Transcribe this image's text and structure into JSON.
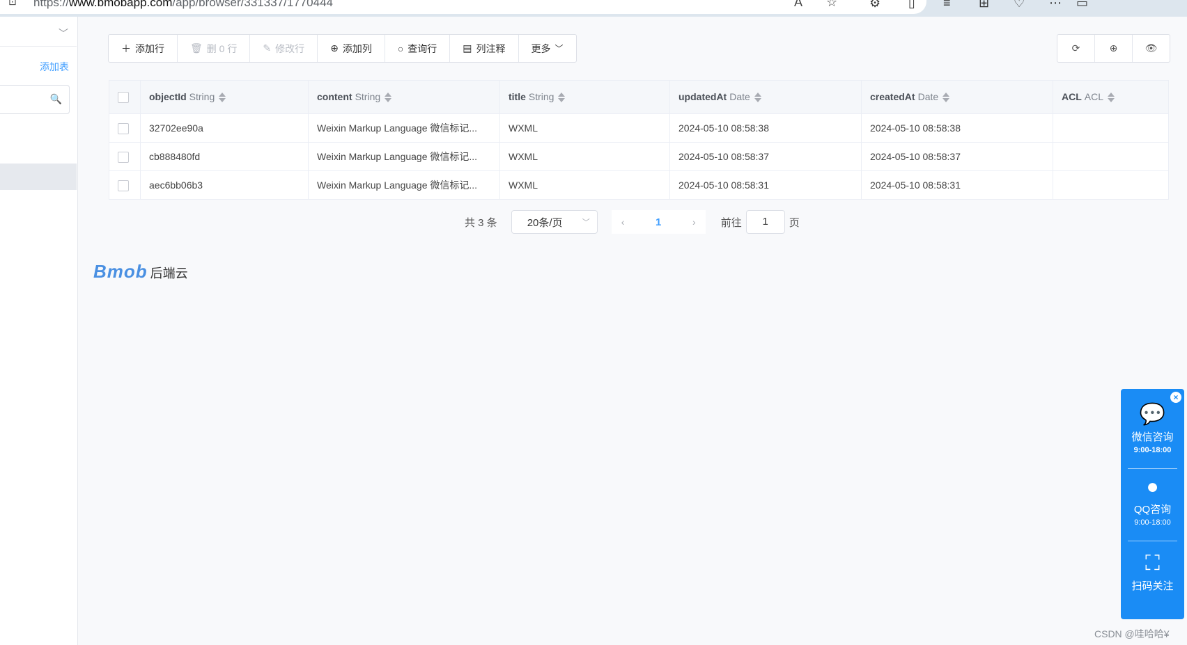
{
  "browser": {
    "url_prefix": "https://",
    "url_domain": "www.bmobapp.com",
    "url_path": "/app/browser/331337/1770444"
  },
  "sidebar": {
    "add_table_label": "添加表"
  },
  "toolbar": {
    "add_row": "添加行",
    "delete_rows": "删 0 行",
    "edit_row": "修改行",
    "add_column": "添加列",
    "query_row": "查询行",
    "column_notes": "列注释",
    "more": "更多"
  },
  "table": {
    "columns": [
      {
        "name": "objectId",
        "type": "String"
      },
      {
        "name": "content",
        "type": "String"
      },
      {
        "name": "title",
        "type": "String"
      },
      {
        "name": "updatedAt",
        "type": "Date"
      },
      {
        "name": "createdAt",
        "type": "Date"
      },
      {
        "name": "ACL",
        "type": "ACL"
      }
    ],
    "rows": [
      {
        "objectId": "32702ee90a",
        "content": "Weixin Markup Language 微信标记...",
        "title": "WXML",
        "updatedAt": "2024-05-10 08:58:38",
        "createdAt": "2024-05-10 08:58:38",
        "acl": ""
      },
      {
        "objectId": "cb888480fd",
        "content": "Weixin Markup Language 微信标记...",
        "title": "WXML",
        "updatedAt": "2024-05-10 08:58:37",
        "createdAt": "2024-05-10 08:58:37",
        "acl": ""
      },
      {
        "objectId": "aec6bb06b3",
        "content": "Weixin Markup Language 微信标记...",
        "title": "WXML",
        "updatedAt": "2024-05-10 08:58:31",
        "createdAt": "2024-05-10 08:58:31",
        "acl": ""
      }
    ]
  },
  "pagination": {
    "total": "共 3 条",
    "page_size": "20条/页",
    "current_page": "1",
    "goto_label": "前往",
    "goto_value": "1",
    "page_unit": "页"
  },
  "logo": {
    "mark": "Bmob",
    "subtitle": "后端云"
  },
  "consult": {
    "wechat_label": "微信咨询",
    "wechat_hours": "9:00-18:00",
    "qq_label": "QQ咨询",
    "qq_hours": "9:00-18:00",
    "scan_label": "扫码关注"
  },
  "watermark": "CSDN @哇哈哈¥"
}
